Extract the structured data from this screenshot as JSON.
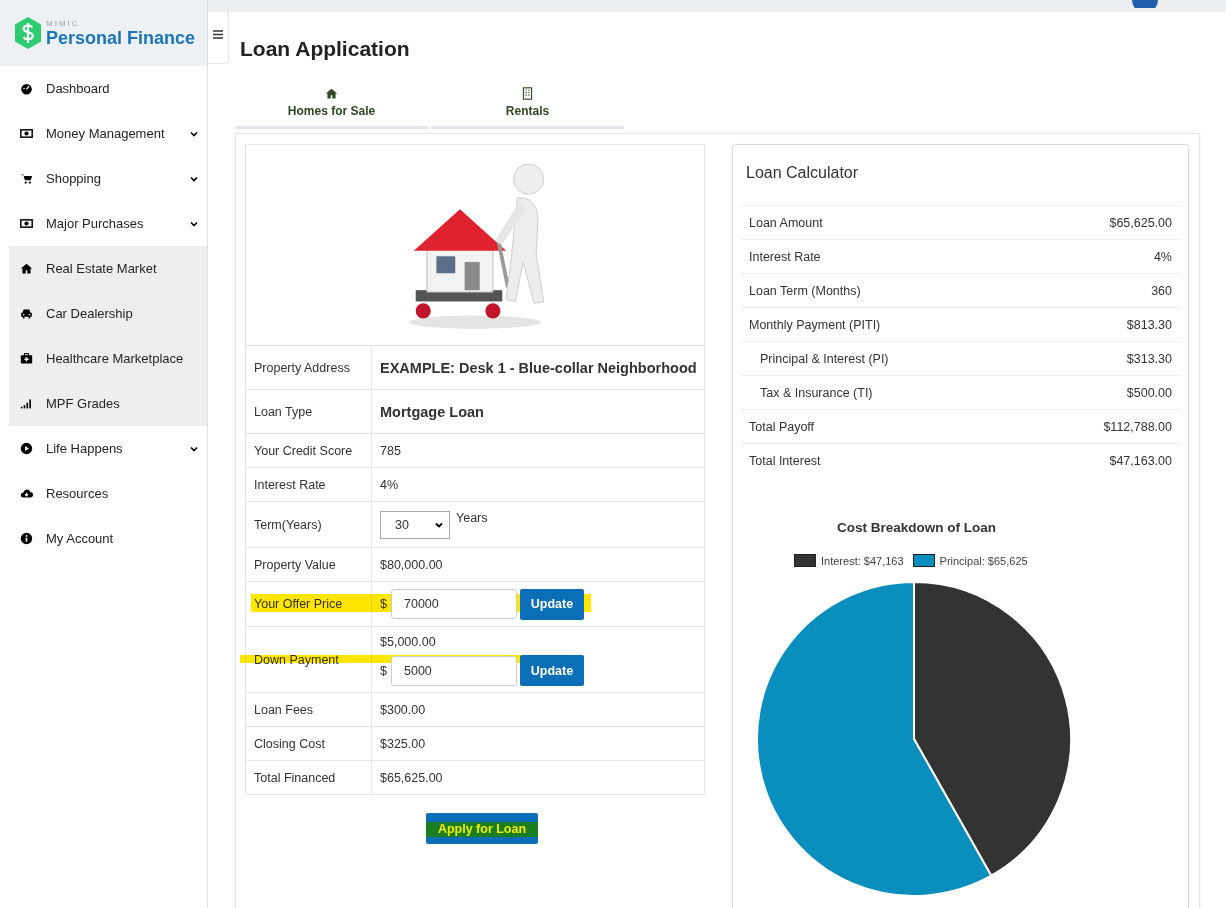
{
  "brand": {
    "small": "MIMIC",
    "name": "Personal Finance"
  },
  "sidebar": {
    "items": [
      {
        "label": "Dashboard",
        "expandable": false
      },
      {
        "label": "Money Management",
        "expandable": true
      },
      {
        "label": "Shopping",
        "expandable": true
      },
      {
        "label": "Major Purchases",
        "expandable": true,
        "children": [
          {
            "label": "Real Estate Market"
          },
          {
            "label": "Car Dealership"
          },
          {
            "label": "Healthcare Marketplace"
          },
          {
            "label": "MPF Grades"
          }
        ]
      },
      {
        "label": "Life Happens",
        "expandable": true
      },
      {
        "label": "Resources",
        "expandable": false
      },
      {
        "label": "My Account",
        "expandable": false
      }
    ]
  },
  "page_title": "Loan Application",
  "tabs": [
    {
      "label": "Homes for Sale",
      "selected": false
    },
    {
      "label": "Rentals",
      "selected": false
    }
  ],
  "application": {
    "rows": [
      {
        "kind": "strong",
        "label": "Property Address",
        "value": "EXAMPLE: Desk 1 - Blue-collar Neighborhood",
        "highlighted": false
      },
      {
        "kind": "strong",
        "label": "Loan Type",
        "value": "Mortgage Loan",
        "highlighted": false
      },
      {
        "kind": "text",
        "label": "Your Credit Score",
        "value": "785",
        "highlighted": false
      },
      {
        "kind": "text",
        "label": "Interest Rate",
        "value": "4%",
        "highlighted": false
      },
      {
        "kind": "select",
        "label": "Term(Years)",
        "value": "30",
        "unit": "Years",
        "highlighted": false
      },
      {
        "kind": "text",
        "label": "Property Value",
        "value": "$80,000.00",
        "highlighted": false
      },
      {
        "kind": "input",
        "label": "Your Offer Price",
        "currency": "$",
        "value": "70000",
        "button": "Update",
        "highlighted": true
      },
      {
        "kind": "amount_input",
        "label": "Down Payment",
        "amount": "$5,000.00",
        "currency": "$",
        "value": "5000",
        "button": "Update",
        "highlighted": true
      },
      {
        "kind": "text",
        "label": "Loan Fees",
        "value": "$300.00",
        "highlighted": false
      },
      {
        "kind": "text",
        "label": "Closing Cost",
        "value": "$325.00",
        "highlighted": false
      },
      {
        "kind": "text",
        "label": "Total Financed",
        "value": "$65,625.00",
        "highlighted": false
      }
    ],
    "apply_button": {
      "label": "Apply for Loan",
      "highlighted": true
    }
  },
  "calculator": {
    "title": "Loan Calculator",
    "rows": [
      {
        "label": "Loan Amount",
        "value": "$65,625.00",
        "indented": false
      },
      {
        "label": "Interest Rate",
        "value": "4%",
        "indented": false
      },
      {
        "label": "Loan Term (Months)",
        "value": "360",
        "indented": false
      },
      {
        "label": "Monthly Payment (PITI)",
        "value": "$813.30",
        "indented": false
      },
      {
        "label": "Principal & Interest (PI)",
        "value": "$313.30",
        "indented": true
      },
      {
        "label": "Tax & Insurance (TI)",
        "value": "$500.00",
        "indented": true
      },
      {
        "label": "Total Payoff",
        "value": "$112,788.00",
        "indented": false
      },
      {
        "label": "Total Interest",
        "value": "$47,163.00",
        "indented": false
      }
    ],
    "chart_data": {
      "type": "pie",
      "title": "Cost Breakdown of Loan",
      "legend": true,
      "categories": [
        "Interest: $47,163",
        "Principal: $65,625"
      ],
      "values": [
        47163,
        65625
      ],
      "colors": [
        "#333333",
        "#0a8ebd"
      ]
    }
  }
}
